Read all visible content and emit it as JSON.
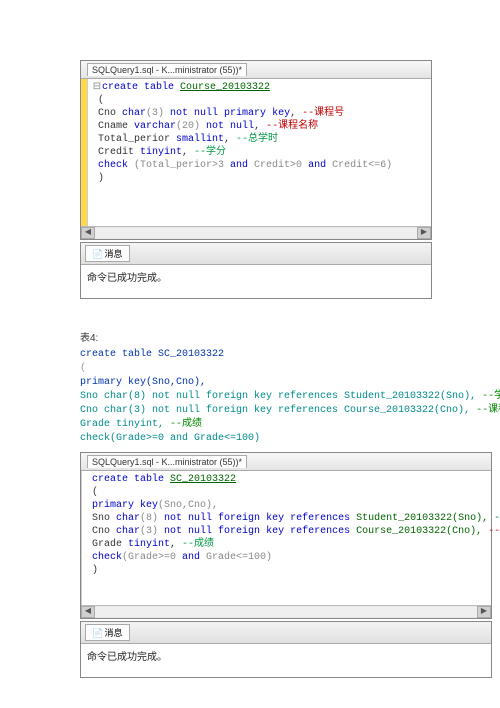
{
  "block1": {
    "title": "SQLQuery1.sql - K...ministrator (55))*",
    "code": {
      "l1a": "create table ",
      "l1b": "Course_20103322",
      "l2": " (",
      "l3a": " Cno ",
      "l3b": "char",
      "l3c": "(3) ",
      "l3d": "not null primary key",
      "l3e": ", ",
      "l3f": "--课程号",
      "l4a": " Cname ",
      "l4b": "varchar",
      "l4c": "(20) ",
      "l4d": "not null",
      "l4e": ", ",
      "l4f": "--课程名称",
      "l5a": " Total_perior ",
      "l5b": "smallint",
      "l5c": ", ",
      "l5d": "--总学时",
      "l6a": " Credit ",
      "l6b": "tinyint",
      "l6c": ", ",
      "l6d": "--学分",
      "l7a": " check ",
      "l7b": "(Total_perior>3 ",
      "l7c": "and",
      "l7d": " Credit>0 ",
      "l7e": "and",
      "l7f": " Credit<=6)",
      "l8": " )"
    },
    "msgtab": "消息",
    "msgbody": "命令已成功完成。"
  },
  "mid": {
    "label": "表4:",
    "l1": "create table SC_20103322",
    "l2": "(",
    "l3": "primary key(Sno,Cno),",
    "l4a": "Sno char(8) not null foreign key references Student_20103322(Sno), ",
    "l4b": "--学号",
    "l5a": "Cno char(3) not null foreign key references Course_20103322(Cno), ",
    "l5b": "--课程号",
    "l6a": "Grade tinyint, ",
    "l6b": "--成绩",
    "l7": "check(Grade>=0 and Grade<=100)"
  },
  "block2": {
    "title": "SQLQuery1.sql - K...ministrator (55))*",
    "code": {
      "l1a": " create table ",
      "l1b": "SC_20103322",
      "l2": " (",
      "l3a": " primary key",
      "l3b": "(Sno,Cno),",
      "l4a": " Sno ",
      "l4b": "char",
      "l4c": "(8) ",
      "l4d": "not null foreign key references",
      "l4e": " Student_20103322(Sno), ",
      "l4f": "--学号",
      "l5a": " Cno ",
      "l5b": "char",
      "l5c": "(3) ",
      "l5d": "not null foreign key references",
      "l5e": " Course_20103322(Cno), ",
      "l5f": "--课程号",
      "l6a": " Grade ",
      "l6b": "tinyint",
      "l6c": ", ",
      "l6d": "--成绩",
      "l7a": " check",
      "l7b": "(Grade>=0 ",
      "l7c": "and",
      "l7d": " Grade<=100)",
      "l8": " )"
    },
    "msgtab": "消息",
    "msgbody": "命令已成功完成。"
  },
  "icons": {
    "page": "📄",
    "left": "◀",
    "right": "▶",
    "expand": "⊟"
  }
}
